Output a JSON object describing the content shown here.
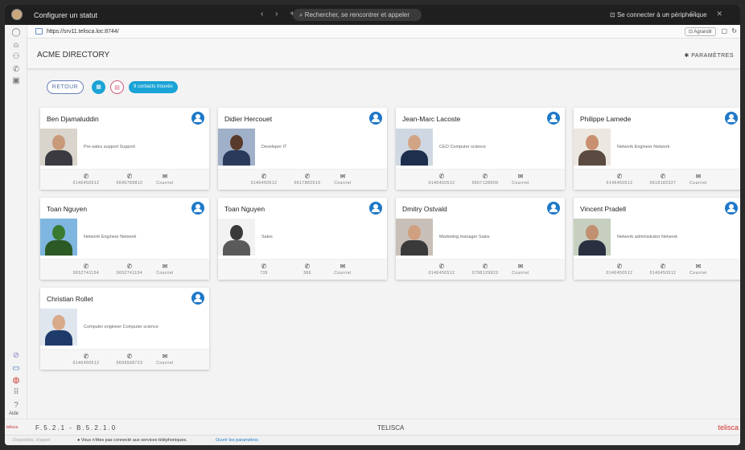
{
  "titlebar": {
    "title": "Configurer un statut",
    "nav": "‹ › +",
    "search_placeholder": "Rechercher, se rencontrer et appeler",
    "connect": "Se connecter à un périphérique",
    "window_controls": "– □ ✕"
  },
  "address": {
    "url": "https://srv11.telisca.loc:8744/",
    "zoom": "Agrandir"
  },
  "app": {
    "title": "ACME DIRECTORY",
    "settings_label": "PARAMÈTRES"
  },
  "toolbar": {
    "back_label": "RETOUR",
    "count_label": "9 contacts trouvés"
  },
  "actions": {
    "mail_label": "Courriel"
  },
  "contacts": [
    {
      "name": "Ben Djamaluddin",
      "desc": "Pre-sales support Support",
      "phone1": "0146450512",
      "phone2": "0645789812"
    },
    {
      "name": "Didier Hercouet",
      "desc": "Developer IT",
      "phone1": "0146450512",
      "phone2": "0617882919"
    },
    {
      "name": "Jean-Marc Lacoste",
      "desc": "CEO Computer science",
      "phone1": "0146450512",
      "phone2": "0667128909"
    },
    {
      "name": "Philippe Lamede",
      "desc": "Network Engineer Network",
      "phone1": "0146450512",
      "phone2": "0618182327"
    },
    {
      "name": "Toan Nguyen",
      "desc": "Network Engineer Network",
      "phone1": "0652741154",
      "phone2": "0652741154"
    },
    {
      "name": "Toan Nguyen",
      "desc": "Sales",
      "phone1": "739",
      "phone2": "366"
    },
    {
      "name": "Dmitry Ostvald",
      "desc": "Marketing manager Sales",
      "phone1": "0146450512",
      "phone2": "0798129923"
    },
    {
      "name": "Vincent Pradell",
      "desc": "Network administrator Network",
      "phone1": "0146450512",
      "phone2": "0146450512"
    },
    {
      "name": "Christian Rollet",
      "desc": "Computer engineer Computer science",
      "phone1": "0146450512",
      "phone2": "0699568723"
    }
  ],
  "rail": {
    "help_label": "Aide",
    "brand_small": "telisca"
  },
  "footer": {
    "version": "F.5.2.1 - B.5.2.1.0",
    "center": "TELISCA",
    "brand": "telisca"
  },
  "status": {
    "presence": "Disponible, d'appel",
    "message": "Vous n'êtes pas connecté aux services téléphoniques.",
    "link": "Ouvrir les paramètres"
  },
  "colors": {
    "accent": "#1aa3d6",
    "profile_button": "#1e78c8",
    "brand_red": "#d0312d"
  }
}
